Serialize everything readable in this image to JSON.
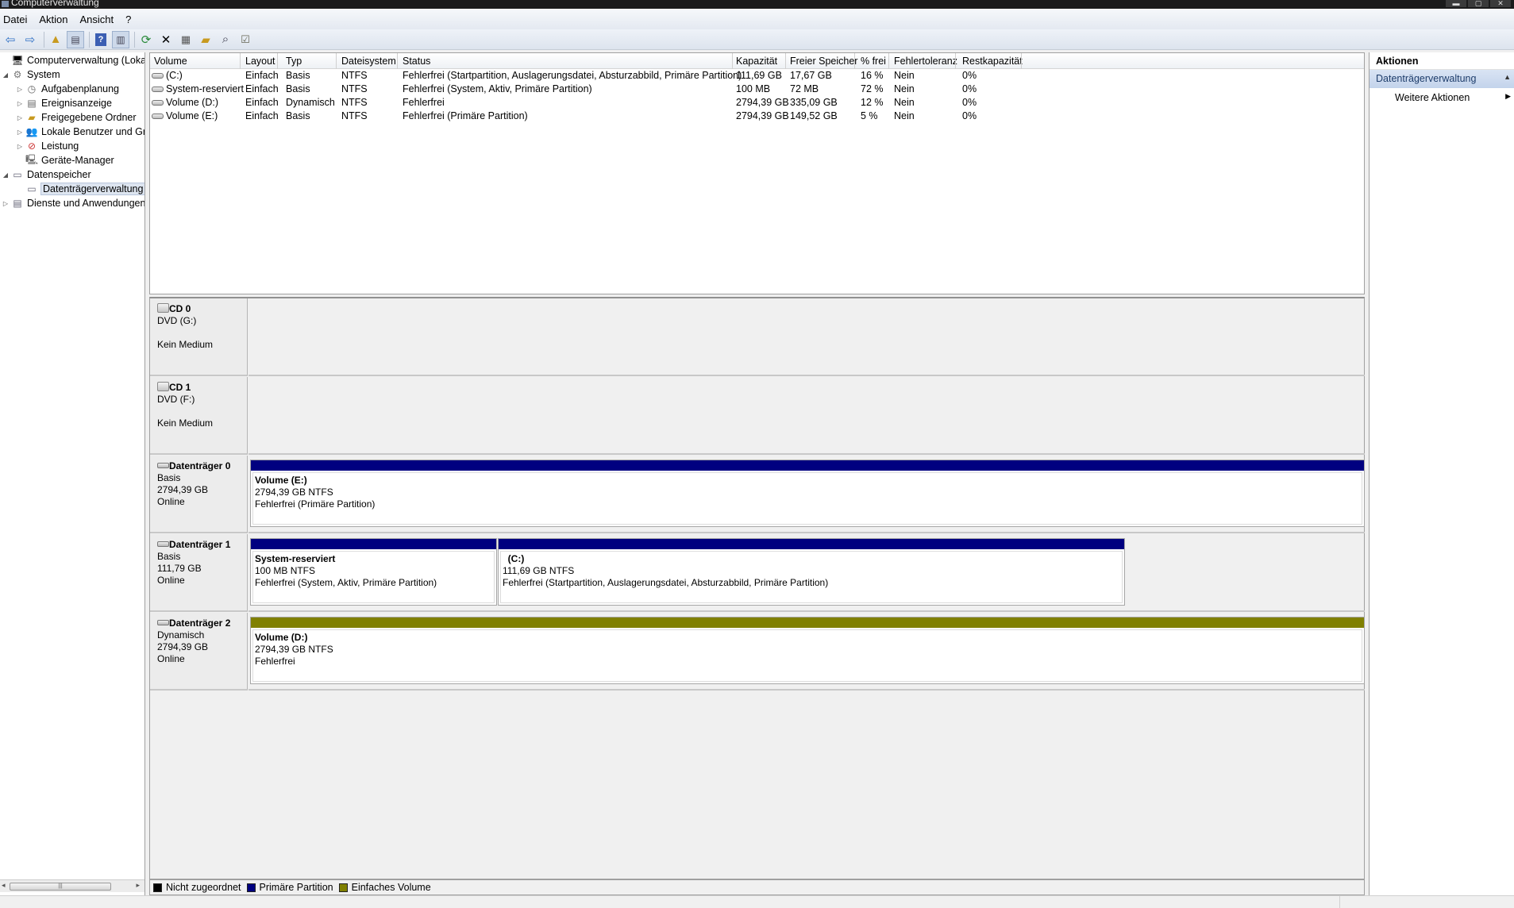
{
  "window": {
    "title": "Computerverwaltung"
  },
  "menu": [
    "Datei",
    "Aktion",
    "Ansicht",
    "?"
  ],
  "toolbar_icons": [
    "back-arrow-icon",
    "forward-arrow-icon",
    "up-folder-icon",
    "show-hide-tree-icon",
    "help-icon",
    "show-hide-action-pane-icon",
    "refresh-icon",
    "delete-icon",
    "properties-icon",
    "open-folder-icon",
    "search-icon",
    "checklist-icon"
  ],
  "tree": {
    "items": [
      {
        "label": "Computerverwaltung (Lokal)",
        "icon": "computer-management-icon",
        "expander": ""
      },
      {
        "label": "System",
        "icon": "system-tools-icon",
        "expander": "◢"
      },
      {
        "label": "Aufgabenplanung",
        "icon": "task-scheduler-icon",
        "expander": "▷"
      },
      {
        "label": "Ereignisanzeige",
        "icon": "event-viewer-icon",
        "expander": "▷"
      },
      {
        "label": "Freigegebene Ordner",
        "icon": "shared-folders-icon",
        "expander": "▷"
      },
      {
        "label": "Lokale Benutzer und Gr",
        "icon": "local-users-icon",
        "expander": "▷"
      },
      {
        "label": "Leistung",
        "icon": "performance-icon",
        "expander": "▷"
      },
      {
        "label": "Geräte-Manager",
        "icon": "device-manager-icon",
        "expander": ""
      },
      {
        "label": "Datenspeicher",
        "icon": "storage-icon",
        "expander": "◢"
      },
      {
        "label": "Datenträgerverwaltung",
        "icon": "disk-management-icon",
        "expander": ""
      },
      {
        "label": "Dienste und Anwendungen",
        "icon": "services-apps-icon",
        "expander": "▷"
      }
    ]
  },
  "volumes": {
    "columns": [
      "Volume",
      "Layout",
      "Typ",
      "Dateisystem",
      "Status",
      "Kapazität",
      "Freier Speicher",
      "% frei",
      "Fehlertoleranz",
      "Restkapazität"
    ],
    "rows": [
      [
        "(C:)",
        "Einfach",
        "Basis",
        "NTFS",
        "Fehlerfrei (Startpartition, Auslagerungsdatei, Absturzabbild, Primäre Partition)",
        "111,69 GB",
        "17,67 GB",
        "16 %",
        "Nein",
        "0%"
      ],
      [
        "System-reserviert",
        "Einfach",
        "Basis",
        "NTFS",
        "Fehlerfrei (System, Aktiv, Primäre Partition)",
        "100 MB",
        "72 MB",
        "72 %",
        "Nein",
        "0%"
      ],
      [
        "Volume (D:)",
        "Einfach",
        "Dynamisch",
        "NTFS",
        "Fehlerfrei",
        "2794,39 GB",
        "335,09 GB",
        "12 %",
        "Nein",
        "0%"
      ],
      [
        "Volume (E:)",
        "Einfach",
        "Basis",
        "NTFS",
        "Fehlerfrei (Primäre Partition)",
        "2794,39 GB",
        "149,52 GB",
        "5 %",
        "Nein",
        "0%"
      ]
    ]
  },
  "disks": [
    {
      "name": "CD 0",
      "kind": "cd",
      "line1": "DVD (G:)",
      "line2": "",
      "line3": "Kein Medium",
      "partitions": []
    },
    {
      "name": "CD 1",
      "kind": "cd",
      "line1": "DVD (F:)",
      "line2": "",
      "line3": "Kein Medium",
      "partitions": []
    },
    {
      "name": "Datenträger 0",
      "kind": "hd",
      "line1": "Basis",
      "line2": "2794,39 GB",
      "line3": "Online",
      "partitions": [
        {
          "title": "Volume  (E:)",
          "size": "2794,39 GB NTFS",
          "status": "Fehlerfrei (Primäre Partition)",
          "type": "primary"
        }
      ]
    },
    {
      "name": "Datenträger 1",
      "kind": "hd",
      "line1": "Basis",
      "line2": "111,79 GB",
      "line3": "Online",
      "partitions": [
        {
          "title": "System-reserviert",
          "size": "100 MB NTFS",
          "status": "Fehlerfrei (System, Aktiv, Primäre Partition)",
          "type": "primary"
        },
        {
          "title": "  (C:)",
          "size": "111,69 GB NTFS",
          "status": "Fehlerfrei (Startpartition, Auslagerungsdatei, Absturzabbild, Primäre Partition)",
          "type": "primary"
        }
      ]
    },
    {
      "name": "Datenträger 2",
      "kind": "hd",
      "line1": "Dynamisch",
      "line2": "2794,39 GB",
      "line3": "Online",
      "partitions": [
        {
          "title": "Volume  (D:)",
          "size": "2794,39 GB NTFS",
          "status": "Fehlerfrei",
          "type": "simple"
        }
      ]
    }
  ],
  "legend": [
    {
      "label": "Nicht zugeordnet",
      "color": "#000000"
    },
    {
      "label": "Primäre Partition",
      "color": "#000080"
    },
    {
      "label": "Einfaches Volume",
      "color": "#808000"
    }
  ],
  "actions": {
    "title": "Aktionen",
    "section": "Datenträgerverwaltung",
    "items": [
      "Weitere Aktionen"
    ]
  }
}
